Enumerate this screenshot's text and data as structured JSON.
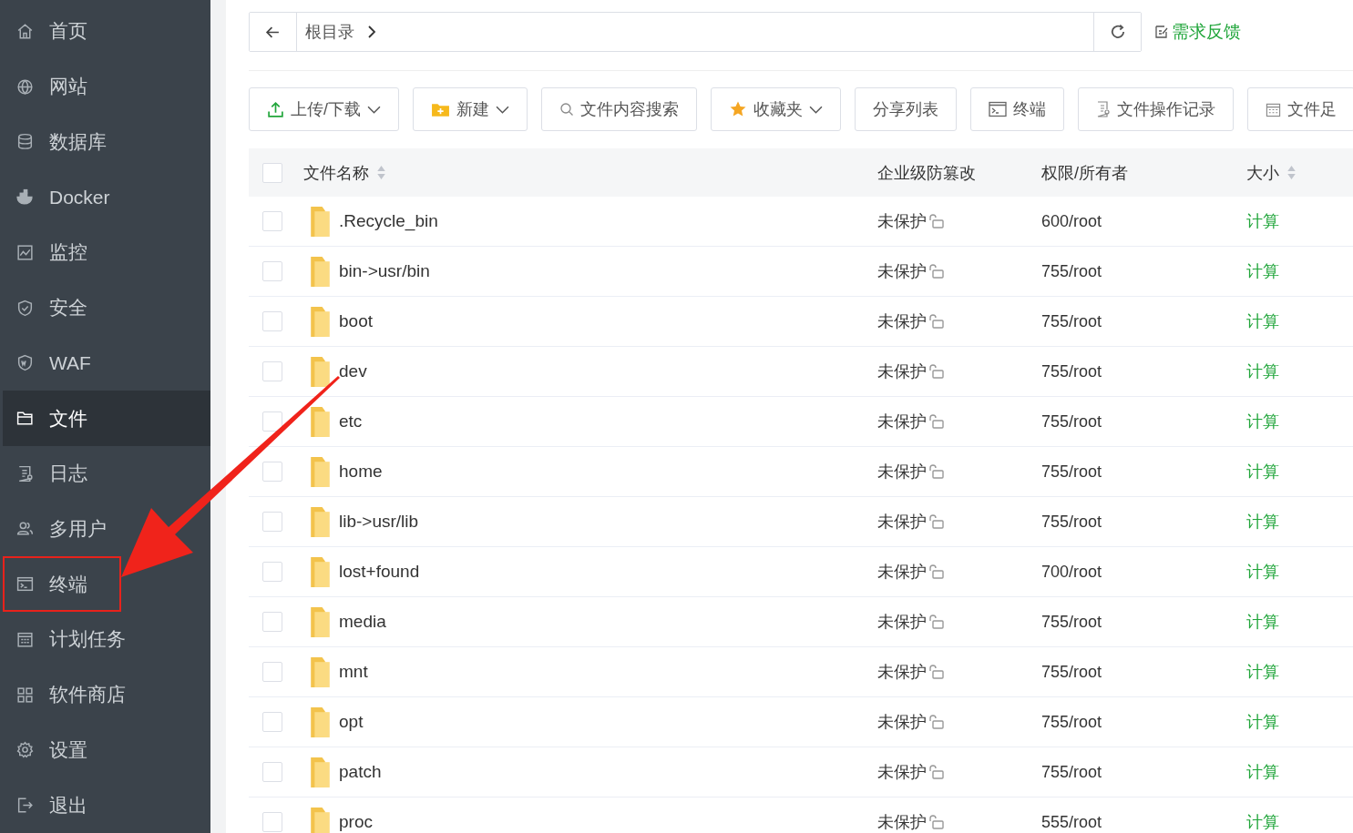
{
  "sidebar": {
    "items": [
      {
        "label": "首页",
        "kind": "home",
        "selected": false,
        "highlighted": false
      },
      {
        "label": "网站",
        "kind": "globe",
        "selected": false,
        "highlighted": false
      },
      {
        "label": "数据库",
        "kind": "database",
        "selected": false,
        "highlighted": false
      },
      {
        "label": "Docker",
        "kind": "docker",
        "selected": false,
        "highlighted": false
      },
      {
        "label": "监控",
        "kind": "monitor",
        "selected": false,
        "highlighted": false
      },
      {
        "label": "安全",
        "kind": "shield",
        "selected": false,
        "highlighted": false
      },
      {
        "label": "WAF",
        "kind": "waf",
        "selected": false,
        "highlighted": false
      },
      {
        "label": "文件",
        "kind": "folder",
        "selected": true,
        "highlighted": false
      },
      {
        "label": "日志",
        "kind": "log",
        "selected": false,
        "highlighted": false
      },
      {
        "label": "多用户",
        "kind": "users",
        "selected": false,
        "highlighted": false
      },
      {
        "label": "终端",
        "kind": "terminal",
        "selected": false,
        "highlighted": true
      },
      {
        "label": "计划任务",
        "kind": "calendar",
        "selected": false,
        "highlighted": false
      },
      {
        "label": "软件商店",
        "kind": "apps",
        "selected": false,
        "highlighted": false
      },
      {
        "label": "设置",
        "kind": "gear",
        "selected": false,
        "highlighted": false
      },
      {
        "label": "退出",
        "kind": "logout",
        "selected": false,
        "highlighted": false
      }
    ]
  },
  "path_bar": {
    "breadcrumb": "根目录",
    "feedback_link": "需求反馈"
  },
  "toolbar": [
    {
      "label": "上传/下载",
      "kind": "upload",
      "dropdown": true
    },
    {
      "label": "新建",
      "kind": "new",
      "dropdown": true
    },
    {
      "label": "文件内容搜索",
      "kind": "search",
      "dropdown": false
    },
    {
      "label": "收藏夹",
      "kind": "star",
      "dropdown": true
    },
    {
      "label": "分享列表",
      "kind": "plain",
      "dropdown": false
    },
    {
      "label": "终端",
      "kind": "terminal",
      "dropdown": false
    },
    {
      "label": "文件操作记录",
      "kind": "log",
      "dropdown": false
    },
    {
      "label": "文件足",
      "kind": "calendar",
      "dropdown": false
    }
  ],
  "table": {
    "select_all_checked": false,
    "columns": [
      "文件名称",
      "企业级防篡改",
      "权限/所有者",
      "大小"
    ],
    "rows": [
      {
        "name": ".Recycle_bin",
        "protection": "未保护",
        "permissions": "600/root",
        "size": "计算",
        "checked": false
      },
      {
        "name": "bin->usr/bin",
        "protection": "未保护",
        "permissions": "755/root",
        "size": "计算",
        "checked": false
      },
      {
        "name": "boot",
        "protection": "未保护",
        "permissions": "755/root",
        "size": "计算",
        "checked": false
      },
      {
        "name": "dev",
        "protection": "未保护",
        "permissions": "755/root",
        "size": "计算",
        "checked": false
      },
      {
        "name": "etc",
        "protection": "未保护",
        "permissions": "755/root",
        "size": "计算",
        "checked": false
      },
      {
        "name": "home",
        "protection": "未保护",
        "permissions": "755/root",
        "size": "计算",
        "checked": false
      },
      {
        "name": "lib->usr/lib",
        "protection": "未保护",
        "permissions": "755/root",
        "size": "计算",
        "checked": false
      },
      {
        "name": "lost+found",
        "protection": "未保护",
        "permissions": "700/root",
        "size": "计算",
        "checked": false
      },
      {
        "name": "media",
        "protection": "未保护",
        "permissions": "755/root",
        "size": "计算",
        "checked": false
      },
      {
        "name": "mnt",
        "protection": "未保护",
        "permissions": "755/root",
        "size": "计算",
        "checked": false
      },
      {
        "name": "opt",
        "protection": "未保护",
        "permissions": "755/root",
        "size": "计算",
        "checked": false
      },
      {
        "name": "patch",
        "protection": "未保护",
        "permissions": "755/root",
        "size": "计算",
        "checked": false
      },
      {
        "name": "proc",
        "protection": "未保护",
        "permissions": "555/root",
        "size": "计算",
        "checked": false
      }
    ]
  }
}
